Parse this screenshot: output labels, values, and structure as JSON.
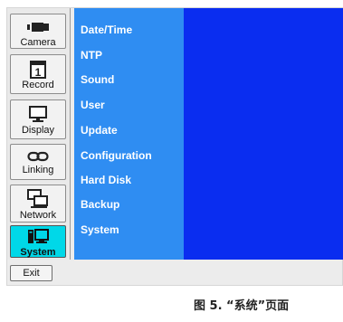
{
  "sidebar": {
    "tabs": [
      {
        "label": "Camera",
        "icon": "camera-icon"
      },
      {
        "label": "Record",
        "icon": "calendar-icon"
      },
      {
        "label": "Display",
        "icon": "monitor-icon"
      },
      {
        "label": "Linking",
        "icon": "chain-link-icon"
      },
      {
        "label": "Network",
        "icon": "network-icon"
      },
      {
        "label": "System",
        "icon": "system-icon"
      }
    ],
    "active": "System",
    "record_day": "1"
  },
  "menu": {
    "items": [
      "Date/Time",
      "NTP",
      "Sound",
      "User",
      "Update",
      "Configuration",
      "Hard Disk",
      "Backup",
      "System"
    ]
  },
  "footer": {
    "exit_label": "Exit"
  },
  "caption": "图 5. “系统”页面",
  "colors": {
    "menu_bg": "#2f8df2",
    "content_bg": "#0a2df0",
    "active_tab": "#00d8e8"
  }
}
